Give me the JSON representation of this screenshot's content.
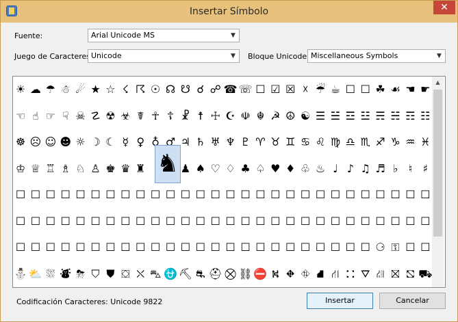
{
  "window": {
    "title": "Insertar Símbolo",
    "close_glyph": "✕"
  },
  "font_label": "Fuente:",
  "font_value": "Arial Unicode MS",
  "charset_label": "Juego de Caracteres:",
  "charset_value": "Unicode",
  "block_label": "Bloque Unicode:",
  "block_value": "Miscellaneous Symbols",
  "symbol_rows": [
    [
      "☀",
      "☁",
      "☂",
      "☃",
      "☄",
      "★",
      "☆",
      "☇",
      "☈",
      "☉",
      "☊",
      "☋",
      "☌",
      "☍",
      "☎",
      "☏",
      "☐",
      "☑",
      "☒",
      "☓",
      "☔",
      "☕",
      "☐",
      "☐",
      "☘",
      "☙",
      "☚",
      "☛"
    ],
    [
      "☜",
      "☝",
      "☞",
      "☟",
      "☠",
      "☡",
      "☢",
      "☣",
      "☤",
      "☥",
      "☦",
      "☧",
      "☨",
      "☩",
      "☪",
      "☫",
      "☬",
      "☭",
      "☮",
      "☯",
      "☰",
      "☱",
      "☲",
      "☳",
      "☴",
      "☵",
      "☶",
      "☷"
    ],
    [
      "☸",
      "☹",
      "☺",
      "☻",
      "☼",
      "☽",
      "☾",
      "☿",
      "♀",
      "♁",
      "♂",
      "♃",
      "♄",
      "♅",
      "♆",
      "♇",
      "♈",
      "♉",
      "♊",
      "♋",
      "♌",
      "♍",
      "♎",
      "♏",
      "♐",
      "♑",
      "♒",
      "♓"
    ],
    [
      "♔",
      "♕",
      "♖",
      "♗",
      "♘",
      "♙",
      "♚",
      "♛",
      "♜",
      "",
      "♞",
      "♟",
      "♠",
      "♡",
      "♢",
      "♣",
      "♤",
      "♥",
      "♦",
      "♧",
      "♨",
      "♩",
      "♪",
      "♫",
      "♬",
      "♭",
      "♮",
      "♯"
    ],
    [
      "☐",
      "☐",
      "☐",
      "☐",
      "☐",
      "☐",
      "☐",
      "☐",
      "☐",
      "☐",
      "☐",
      "☐",
      "☐",
      "☐",
      "☐",
      "☐",
      "☐",
      "☐",
      "☐",
      "☐",
      "☐",
      "☐",
      "☐",
      "☐",
      "☐",
      "☐",
      "☐",
      "☐"
    ],
    [
      "☐",
      "☐",
      "☐",
      "☐",
      "☐",
      "☐",
      "☐",
      "☐",
      "☐",
      "☐",
      "☐",
      "☐",
      "☐",
      "☐",
      "☐",
      "☐",
      "☐",
      "☐",
      "☐",
      "☐",
      "☐",
      "☐",
      "☐",
      "☐",
      "☐",
      "☐",
      "☐",
      "☐"
    ],
    [
      "☐",
      "☐",
      "☐",
      "☐",
      "☐",
      "☐",
      "☐",
      "☐",
      "☐",
      "☐",
      "☐",
      "☐",
      "☐",
      "☐",
      "☐",
      "☐",
      "☐",
      "☐",
      "☐",
      "☐",
      "☐",
      "☐",
      "☐",
      "☐",
      "⚆",
      "⚿",
      "☐",
      "☐"
    ],
    [
      "⛄",
      "⛅",
      "⛆",
      "⛇",
      "⛈",
      "⛉",
      "⛊",
      "⛋",
      "⛌",
      "⛍",
      "⛎",
      "⛏",
      "⛐",
      "⛑",
      "⛒",
      "⛓",
      "⛔",
      "⛕",
      "⛖",
      "⛗",
      "⛘",
      "⛙",
      "⛚",
      "⛛",
      "⛜",
      "⛝",
      "⛞",
      "⛟"
    ]
  ],
  "selected_symbol": "♞",
  "status_text": "Codificación Caracteres: Unicode 9822",
  "insert_label": "Insertar",
  "cancel_label": "Cancelar"
}
